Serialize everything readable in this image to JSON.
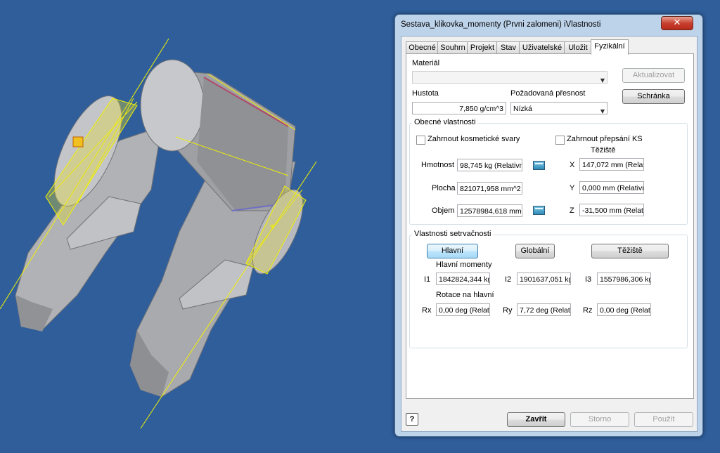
{
  "dialog": {
    "title": "Sestava_klikovka_momenty (Prvni zalomeni) iVlastnosti",
    "close": "✕",
    "tabs": [
      {
        "label": "Obecné"
      },
      {
        "label": "Souhrn"
      },
      {
        "label": "Projekt"
      },
      {
        "label": "Stav"
      },
      {
        "label": "Uživatelské"
      },
      {
        "label": "Uložit"
      },
      {
        "label": "Fyzikální"
      }
    ],
    "active_tab": "Fyzikální"
  },
  "physical": {
    "material_label": "Materiál",
    "material_value": "",
    "update_button": "Aktualizovat",
    "clipboard_button": "Schránka",
    "density_label": "Hustota",
    "density_value": "7,850 g/cm^3",
    "accuracy_label": "Požadovaná přesnost",
    "accuracy_value": "Nízká",
    "general": {
      "group_label": "Obecné vlastnosti",
      "include_cosmetic": "Zahrnout kosmetické svary",
      "include_override": "Zahrnout přepsání KS",
      "centroid_label": "Těžiště",
      "mass_label": "Hmotnost",
      "mass_value": "98,745 kg (Relativní",
      "area_label": "Plocha",
      "area_value": "821071,958 mm^2",
      "volume_label": "Objem",
      "volume_value": "12578984,618 mm^3",
      "x_label": "X",
      "x_value": "147,072 mm (Relativ",
      "y_label": "Y",
      "y_value": "0,000 mm (Relativní",
      "z_label": "Z",
      "z_value": "-31,500 mm (Relativ"
    },
    "inertia": {
      "group_label": "Vlastnosti setrvačnosti",
      "principal_button": "Hlavní",
      "global_button": "Globální",
      "centroid_button": "Těžiště",
      "principal_moments_label": "Hlavní momenty",
      "i1_label": "I1",
      "i1_value": "1842824,344 kg",
      "i2_label": "I2",
      "i2_value": "1901637,051 kg",
      "i3_label": "I3",
      "i3_value": "1557986,306 kg",
      "rotation_label": "Rotace na hlavní",
      "rx_label": "Rx",
      "rx_value": "0,00 deg (Relat",
      "ry_label": "Ry",
      "ry_value": "7,72 deg (Relat",
      "rz_label": "Rz",
      "rz_value": "0,00 deg (Relat"
    }
  },
  "footer": {
    "help": "?",
    "close_button": "Zavřít",
    "cancel_button": "Storno",
    "apply_button": "Použít"
  },
  "colors": {
    "viewport_bg": "#2f5e9b",
    "model_gray": "#b5b7bb",
    "highlight_yellow": "#f2f200",
    "dialog_frame": "#bdd3ea",
    "close_red": "#c84030"
  }
}
